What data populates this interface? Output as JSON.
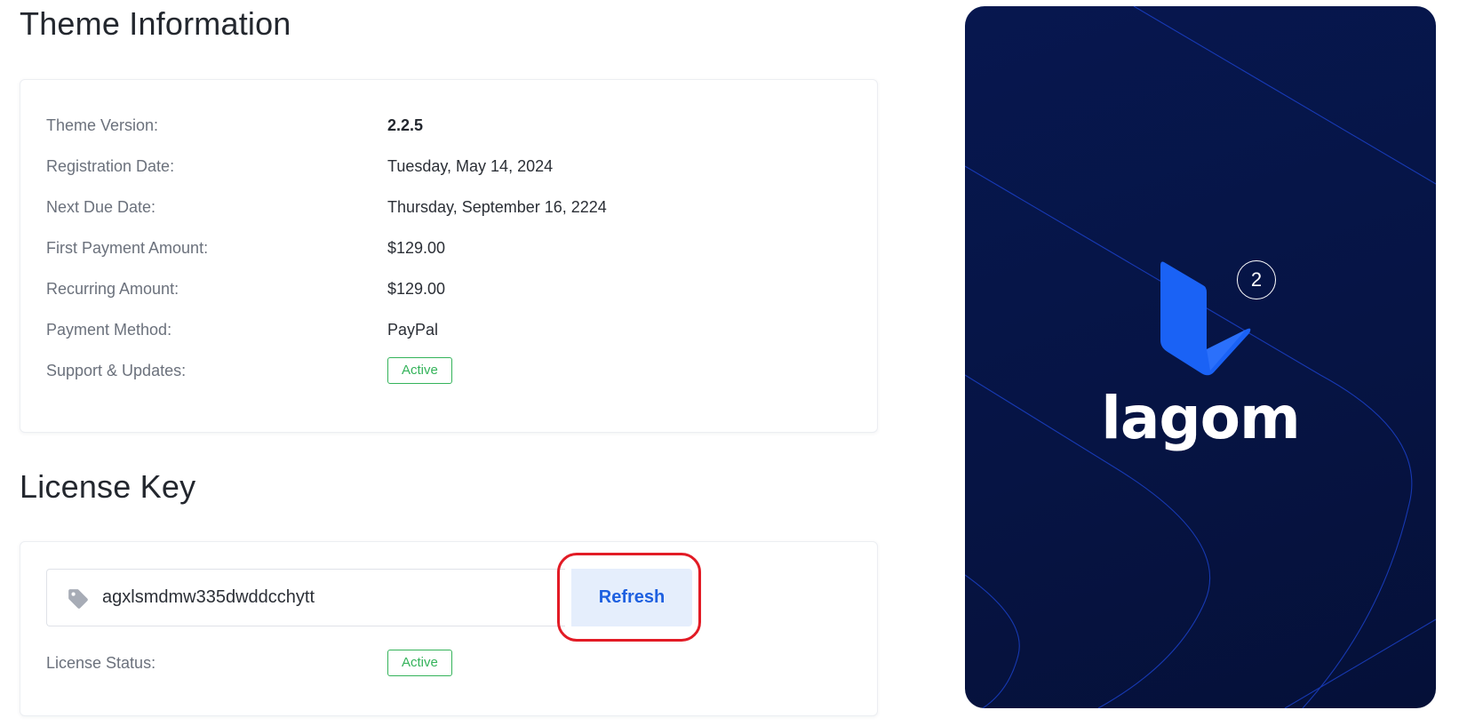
{
  "sections": {
    "theme_title": "Theme Information",
    "license_title": "License Key"
  },
  "theme_info": {
    "version_label": "Theme Version:",
    "version_value": "2.2.5",
    "registration_label": "Registration Date:",
    "registration_value": "Tuesday, May 14, 2024",
    "next_due_label": "Next Due Date:",
    "next_due_value": "Thursday, September 16, 2224",
    "first_payment_label": "First Payment Amount:",
    "first_payment_value": "$129.00",
    "recurring_label": "Recurring Amount:",
    "recurring_value": "$129.00",
    "payment_method_label": "Payment Method:",
    "payment_method_value": "PayPal",
    "support_label": "Support & Updates:",
    "support_status": "Active"
  },
  "license": {
    "key": "agxlsmdmw335dwddcchytt",
    "refresh_label": "Refresh",
    "status_label": "License Status:",
    "status_value": "Active",
    "key_icon": "tag-icon"
  },
  "promo": {
    "brand": "lagom",
    "version_badge": "2"
  },
  "colors": {
    "status_green": "#34b35a",
    "button_blue_text": "#1e60e0",
    "button_blue_bg": "#e5eefc",
    "highlight_red": "#e21b25",
    "promo_bg": "#07174f",
    "brand_blue": "#1a62f5"
  }
}
